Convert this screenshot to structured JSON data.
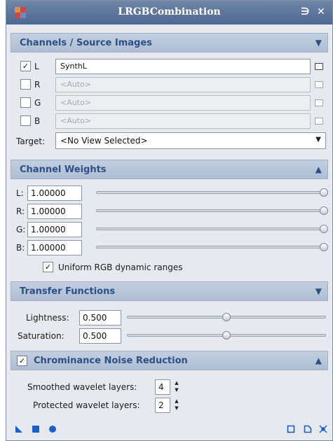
{
  "window": {
    "title": "LRGBCombination"
  },
  "channels": {
    "header": "Channels / Source Images",
    "rows": [
      {
        "label": "L",
        "checked": true,
        "value": "SynthL",
        "enabled": true
      },
      {
        "label": "R",
        "checked": false,
        "value": "<Auto>",
        "enabled": false
      },
      {
        "label": "G",
        "checked": false,
        "value": "<Auto>",
        "enabled": false
      },
      {
        "label": "B",
        "checked": false,
        "value": "<Auto>",
        "enabled": false
      }
    ],
    "target_label": "Target:",
    "target_value": "<No View Selected>"
  },
  "weights": {
    "header": "Channel Weights",
    "rows": [
      {
        "label": "L:",
        "value": "1.00000",
        "fraction": 1.0
      },
      {
        "label": "R:",
        "value": "1.00000",
        "fraction": 1.0
      },
      {
        "label": "G:",
        "value": "1.00000",
        "fraction": 1.0
      },
      {
        "label": "B:",
        "value": "1.00000",
        "fraction": 1.0
      }
    ],
    "uniform_label": "Uniform RGB dynamic ranges",
    "uniform_checked": true
  },
  "transfer": {
    "header": "Transfer Functions",
    "lightness_label": "Lightness:",
    "lightness_value": "0.500",
    "lightness_fraction": 0.5,
    "saturation_label": "Saturation:",
    "saturation_value": "0.500",
    "saturation_fraction": 0.5
  },
  "noise": {
    "header": "Chrominance Noise Reduction",
    "enabled": true,
    "smoothed_label": "Smoothed wavelet layers:",
    "smoothed_value": "4",
    "protected_label": "Protected wavelet layers:",
    "protected_value": "2"
  },
  "icons": {
    "app": "app-icon",
    "pin": "pin-icon",
    "close": "close-icon",
    "new_instance": "triangle-icon",
    "apply_global": "square-icon",
    "apply": "circle-icon",
    "browse": "view-list-icon",
    "reset": "reset-icon",
    "preferences": "preferences-icon"
  },
  "colors": {
    "titlebar": "#5a729a",
    "section_text": "#2c4f86",
    "toolbar_icon": "#1f5ec4"
  }
}
